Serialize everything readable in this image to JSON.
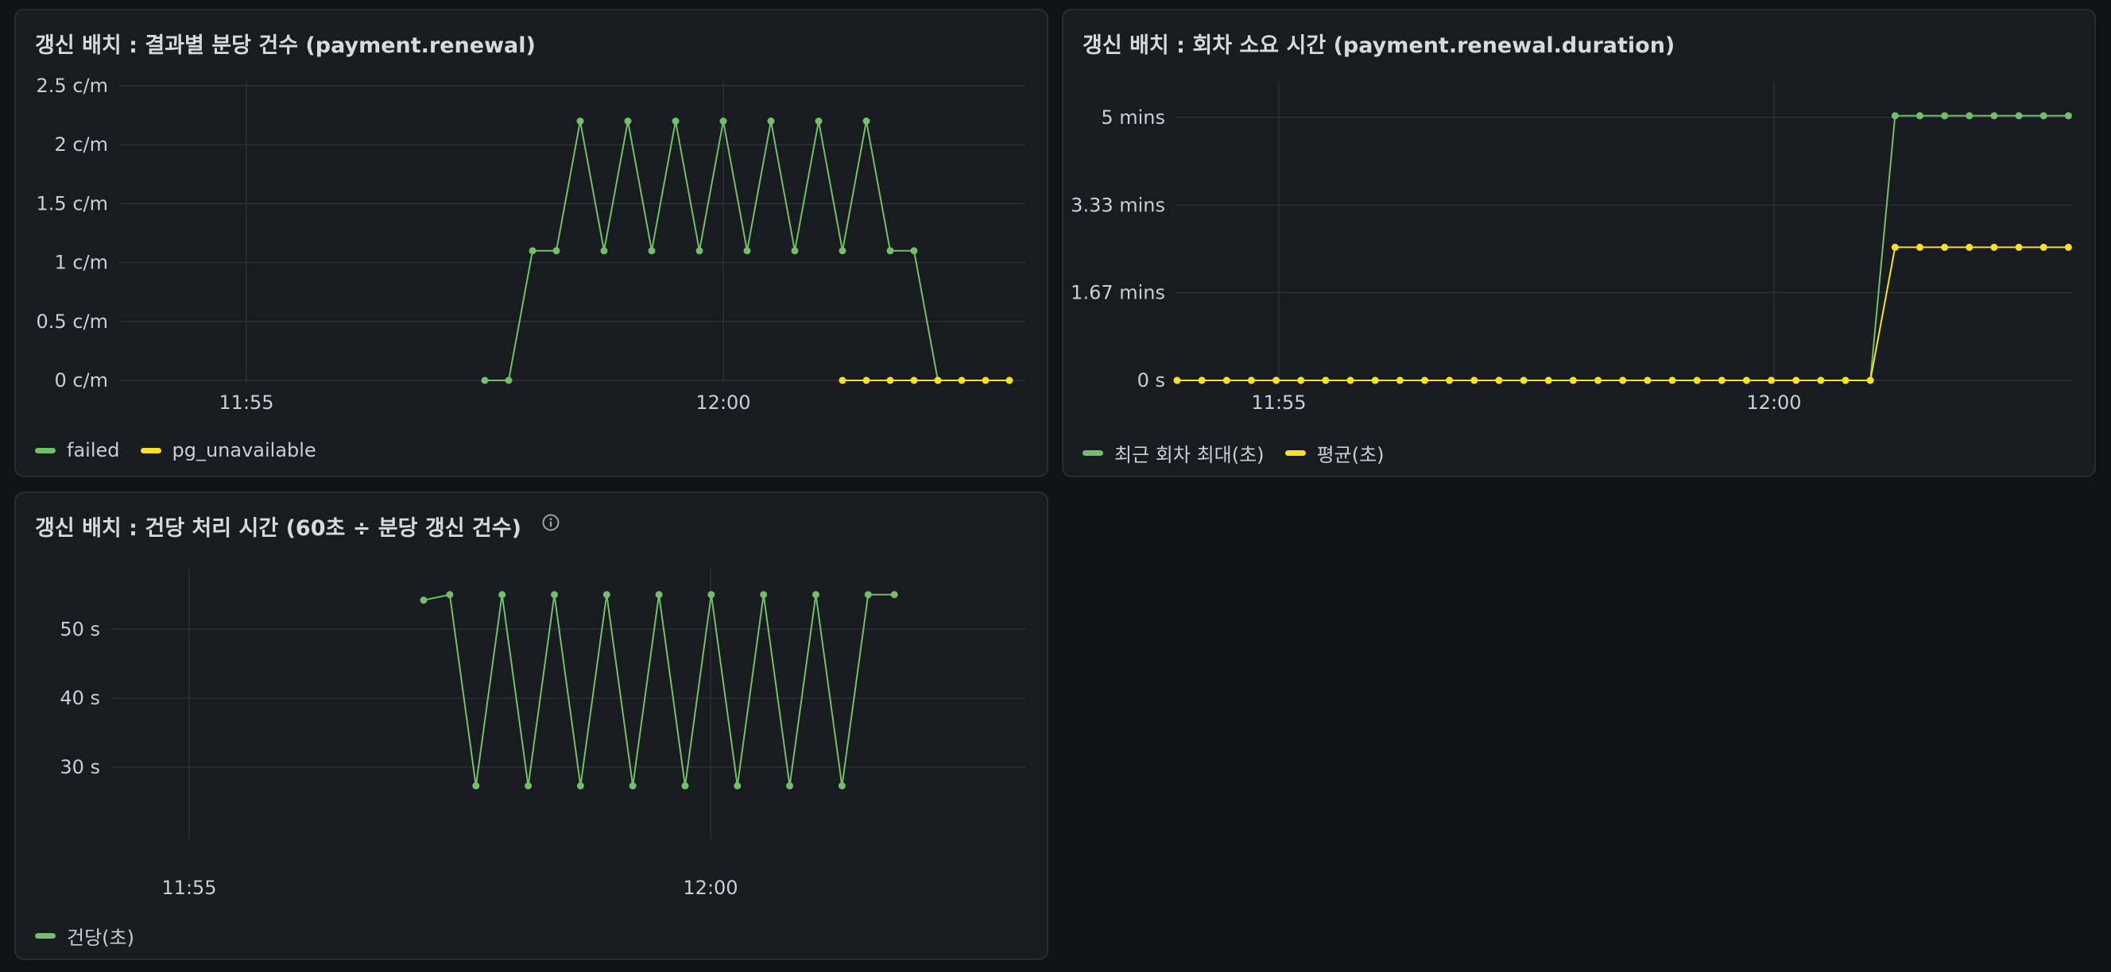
{
  "panels": [
    {
      "title": "갱신 배치 : 결과별 분당 건수 (payment.renewal)",
      "info_icon": null,
      "chart_data": {
        "type": "line",
        "x_unit": "time",
        "x_range": [
          "11:53:40",
          "12:02:40"
        ],
        "x_ticks": [
          "11:55",
          "12:00"
        ],
        "y_unit": "c/m",
        "ylim": [
          0,
          2.5
        ],
        "y_ticks": [
          "0 c/m",
          "0.5 c/m",
          "1 c/m",
          "1.5 c/m",
          "2 c/m",
          "2.5 c/m"
        ],
        "grid": true,
        "legend": "bottom-left",
        "series": [
          {
            "name": "failed",
            "color": "#73bf69",
            "x": [
              "11:57:30",
              "11:57:45",
              "11:58:00",
              "11:58:15",
              "11:58:30",
              "11:58:45",
              "11:59:00",
              "11:59:15",
              "11:59:30",
              "11:59:45",
              "12:00:00",
              "12:00:15",
              "12:00:30",
              "12:00:45",
              "12:01:00",
              "12:01:15",
              "12:01:30",
              "12:01:45",
              "12:02:00",
              "12:02:15",
              "12:02:30"
            ],
            "values": [
              0,
              0,
              1.1,
              1.1,
              2.2,
              1.1,
              2.2,
              1.1,
              2.2,
              1.1,
              2.2,
              1.1,
              2.2,
              1.1,
              2.2,
              1.1,
              2.2,
              1.1,
              1.1,
              0,
              null
            ]
          },
          {
            "name": "pg_unavailable",
            "color": "#fade2a",
            "x": [
              "12:01:15",
              "12:01:30",
              "12:01:45",
              "12:02:00",
              "12:02:15",
              "12:02:30",
              "12:02:45",
              "12:03:00"
            ],
            "values": [
              0,
              0,
              0,
              0,
              0,
              0,
              0,
              0
            ]
          }
        ]
      }
    },
    {
      "title": "갱신 배치 : 회차 소요 시간 (payment.renewal.duration)",
      "info_icon": null,
      "chart_data": {
        "type": "line",
        "x_unit": "time",
        "x_ticks": [
          "11:55",
          "12:00"
        ],
        "y_unit": "mins",
        "ylim": [
          0,
          5.6
        ],
        "y_ticks": [
          "0 s",
          "1.67 mins",
          "3.33 mins",
          "5 mins"
        ],
        "grid": true,
        "legend": "bottom-left",
        "series": [
          {
            "name": "최근 회차 최대(초)",
            "color": "#73bf69",
            "values": [
              0,
              0,
              0,
              0,
              0,
              0,
              0,
              0,
              0,
              0,
              0,
              0,
              0,
              0,
              0,
              0,
              0,
              0,
              0,
              0,
              0,
              0,
              0,
              0,
              0,
              0,
              0,
              0,
              0,
              5.03,
              5.03,
              5.03,
              5.03,
              5.03,
              5.03,
              5.03,
              5.03
            ]
          },
          {
            "name": "평균(초)",
            "color": "#fade2a",
            "values": [
              0,
              0,
              0,
              0,
              0,
              0,
              0,
              0,
              0,
              0,
              0,
              0,
              0,
              0,
              0,
              0,
              0,
              0,
              0,
              0,
              0,
              0,
              0,
              0,
              0,
              0,
              0,
              0,
              0,
              2.53,
              2.53,
              2.53,
              2.53,
              2.53,
              2.53,
              2.53,
              2.53
            ]
          }
        ]
      }
    },
    {
      "title": "갱신 배치 : 건당 처리 시간 (60초 ÷ 분당 갱신 건수)",
      "info_icon": "info-circle-icon",
      "chart_data": {
        "type": "line",
        "x_unit": "time",
        "x_ticks": [
          "11:55",
          "12:00"
        ],
        "y_unit": "s",
        "ylim": [
          20,
          58.2
        ],
        "y_ticks": [
          "30 s",
          "40 s",
          "50 s"
        ],
        "grid": true,
        "legend": "bottom-left",
        "series": [
          {
            "name": "건당(초)",
            "color": "#73bf69",
            "values": [
              54.2,
              55,
              27.3,
              55,
              27.3,
              55,
              27.3,
              55,
              27.3,
              55,
              27.3,
              55,
              27.3,
              55,
              27.3,
              55,
              27.3,
              55,
              55
            ]
          }
        ]
      }
    }
  ],
  "colors": {
    "grid": "#2c3038",
    "axis_text": "#ccccdc",
    "panel_bg": "#181b1f",
    "page_bg": "#111217"
  }
}
